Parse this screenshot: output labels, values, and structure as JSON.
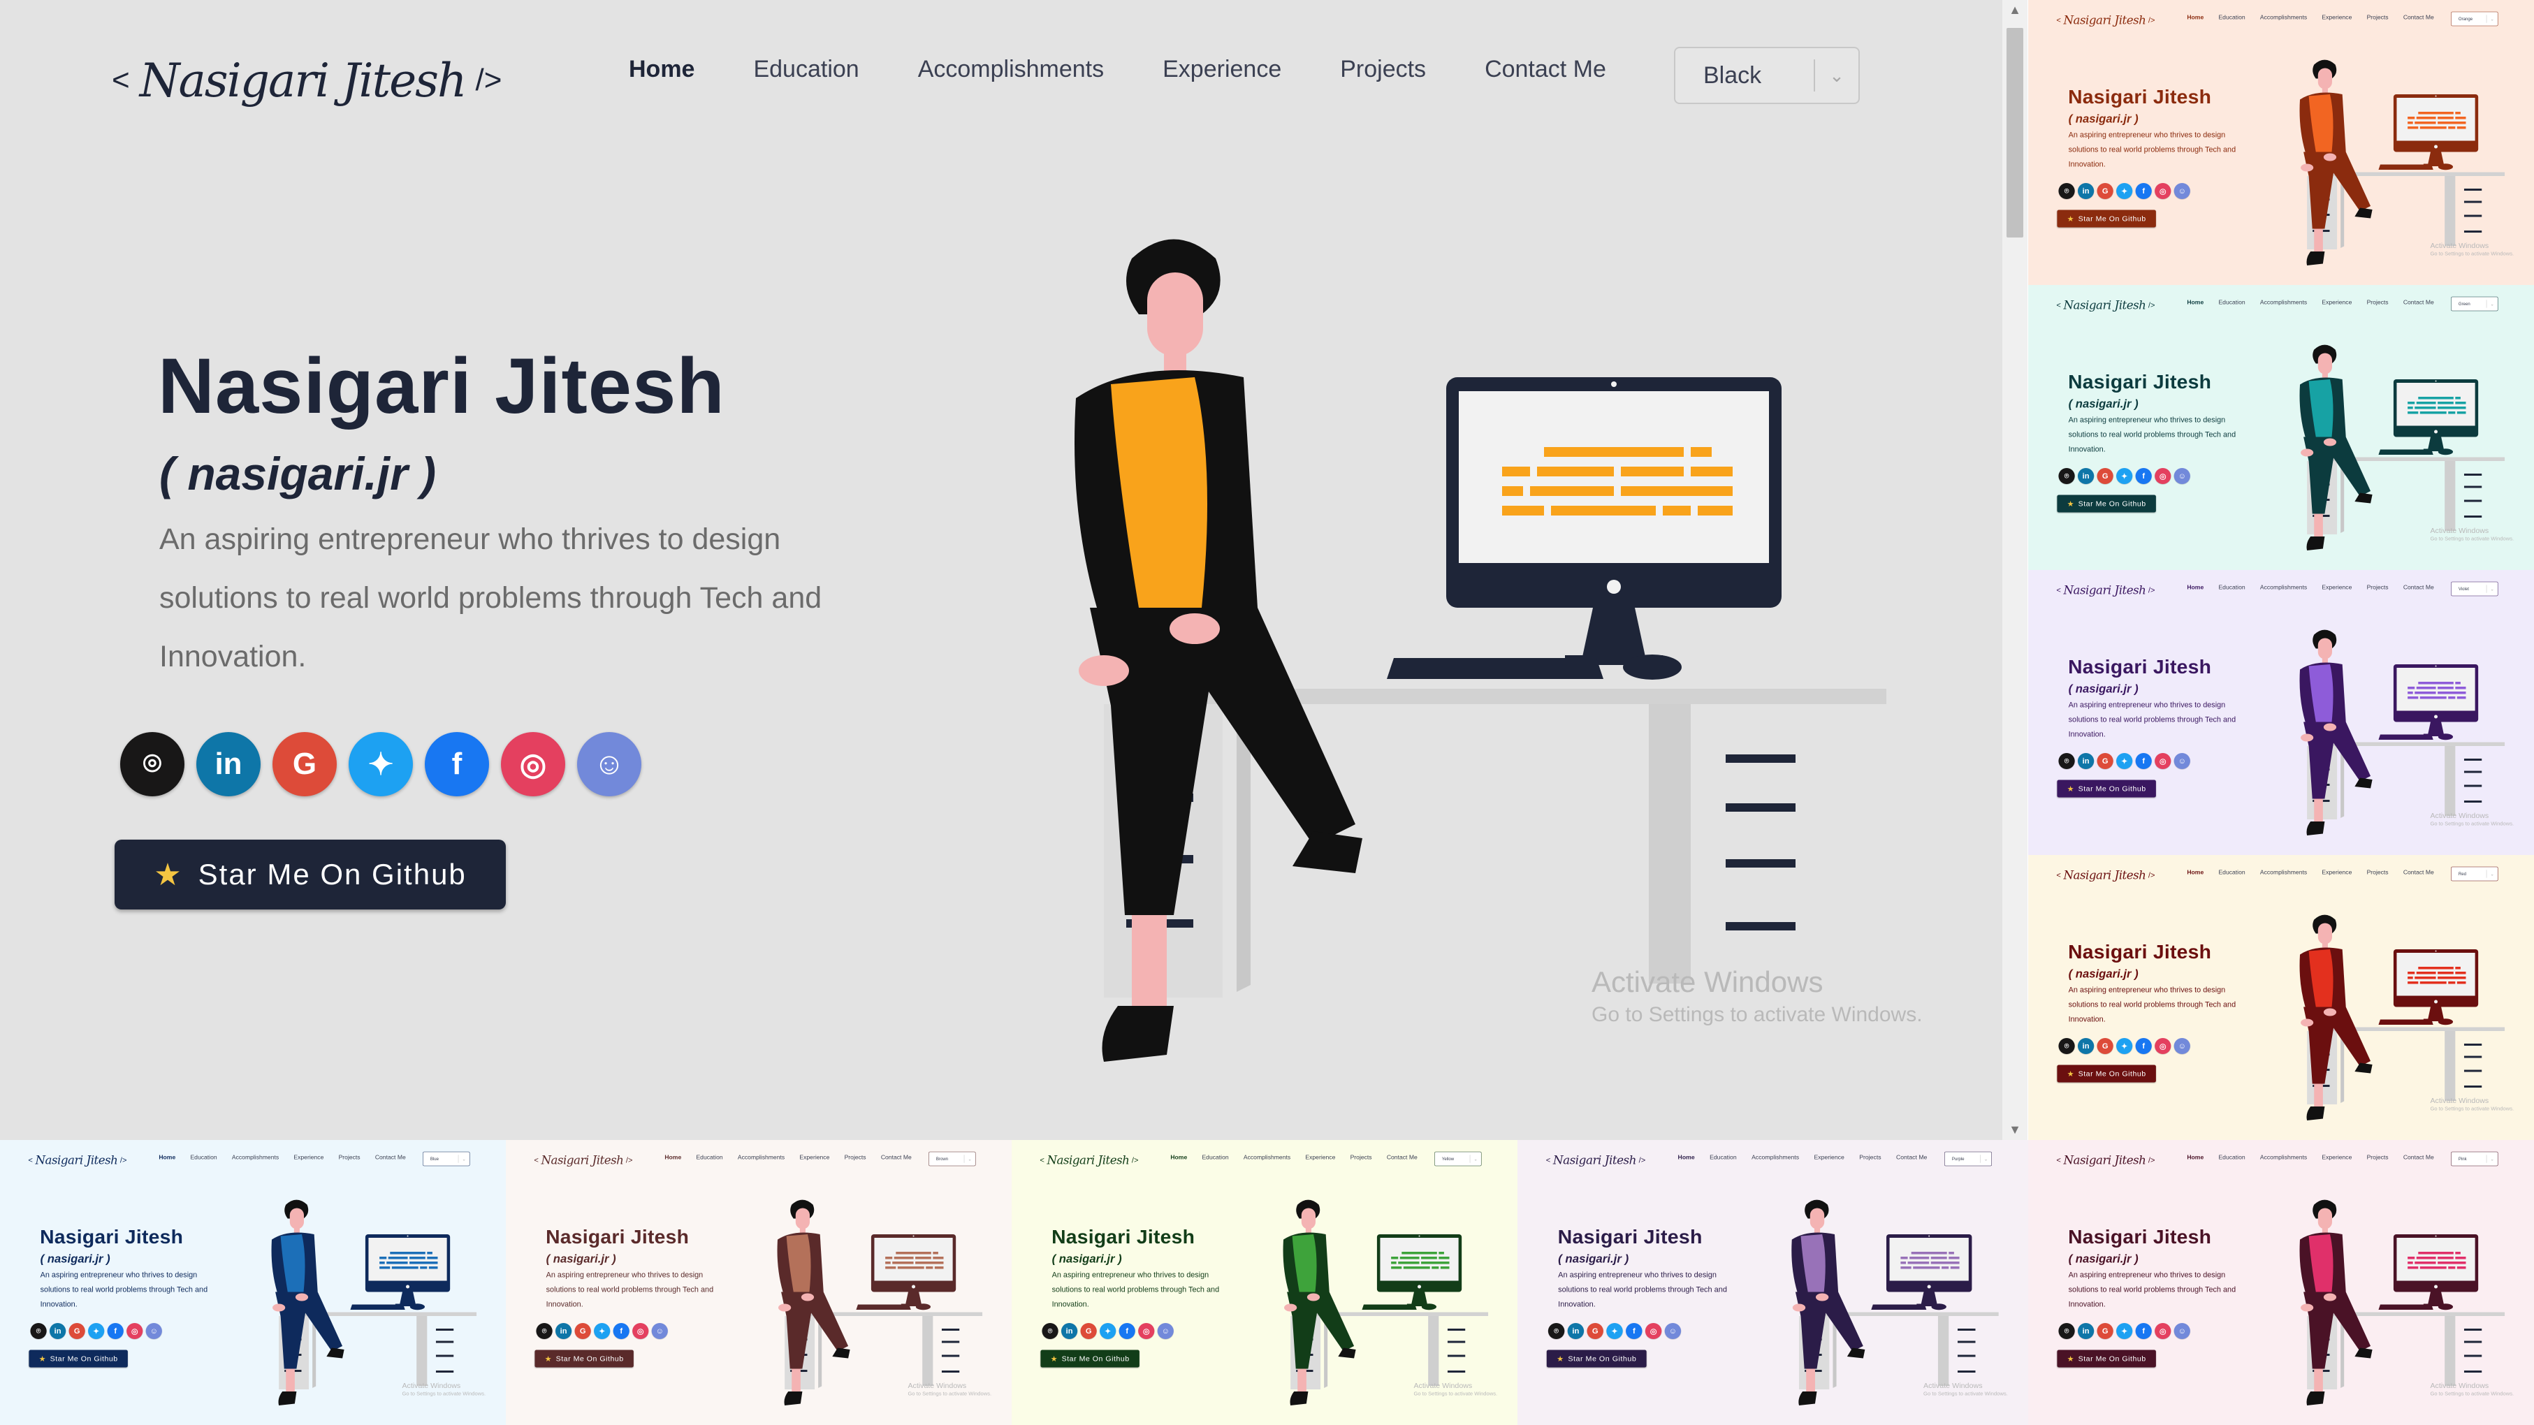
{
  "header": {
    "logo_open": "<",
    "logo_signature": "Nasigari Jitesh",
    "logo_close": "/>",
    "nav": [
      "Home",
      "Education",
      "Accomplishments",
      "Experience",
      "Projects",
      "Contact Me"
    ],
    "theme_value": "Black"
  },
  "hero": {
    "name": "Nasigari Jitesh",
    "nickname": "( nasigari.jr )",
    "description": "An aspiring entrepreneur who thrives to design solutions to real world problems through Tech and Innovation.",
    "github_button": "Star Me On Github",
    "star_glyph": "★"
  },
  "socials": [
    {
      "name": "github",
      "glyph": "⌾",
      "color": "#181717"
    },
    {
      "name": "linkedin",
      "glyph": "in",
      "color": "#0e76a8"
    },
    {
      "name": "google",
      "glyph": "G",
      "color": "#dd4b39"
    },
    {
      "name": "twitter",
      "glyph": "✦",
      "color": "#1da1f2"
    },
    {
      "name": "facebook",
      "glyph": "f",
      "color": "#1877f2"
    },
    {
      "name": "instagram",
      "glyph": "◎",
      "color": "#e4405f"
    },
    {
      "name": "discord",
      "glyph": "☺",
      "color": "#7289da"
    }
  ],
  "watermark": {
    "line1": "Activate Windows",
    "line2": "Go to Settings to activate Windows."
  },
  "colors": {
    "primary": "#1e2538",
    "accent": "#f9a31b",
    "background": "#e3e3e3"
  },
  "themes": [
    {
      "value": "Orange",
      "bg": "#fde9de",
      "c": "#8b2b0e",
      "accent": "#f26522",
      "btn": "#8b2b0e"
    },
    {
      "value": "Green",
      "bg": "#e3f8f3",
      "c": "#0c3b3e",
      "accent": "#17a2a4",
      "btn": "#0c3b3e"
    },
    {
      "value": "Violet",
      "bg": "#f0ebfb",
      "c": "#3a1760",
      "accent": "#8e5cd9",
      "btn": "#3a1760"
    },
    {
      "value": "Red",
      "bg": "#fdf6e3",
      "c": "#6b0f0f",
      "accent": "#e3301e",
      "btn": "#6b0f0f"
    },
    {
      "value": "Blue",
      "bg": "#edf7fd",
      "c": "#0e2a5c",
      "accent": "#1c6fb8",
      "btn": "#0e2a5c"
    },
    {
      "value": "Brown",
      "bg": "#fbf6f3",
      "c": "#5a2a2a",
      "accent": "#b4715a",
      "btn": "#5a2a2a"
    },
    {
      "value": "Yellow",
      "bg": "#fbfde7",
      "c": "#123d18",
      "accent": "#3ea33b",
      "btn": "#123d18"
    },
    {
      "value": "Purple",
      "bg": "#f6f0f6",
      "c": "#2b1c48",
      "accent": "#9872b8",
      "btn": "#2b1c48"
    },
    {
      "value": "Pink",
      "bg": "#fbeef2",
      "c": "#4a1226",
      "accent": "#e0306a",
      "btn": "#4a1226"
    }
  ]
}
